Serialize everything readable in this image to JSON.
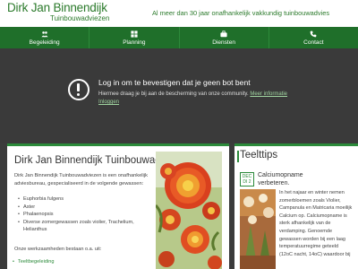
{
  "header": {
    "title": "Dirk Jan Binnendijk",
    "subtitle": "Tuinbouwadviezen",
    "tagline": "Al meer dan 30 jaar onafhankelijk vakkundig tuinbouwadvies"
  },
  "nav": {
    "items": [
      {
        "label": "Begeleiding",
        "icon": "people-icon"
      },
      {
        "label": "Planning",
        "icon": "grid-icon"
      },
      {
        "label": "Diensten",
        "icon": "briefcase-icon"
      },
      {
        "label": "Contact",
        "icon": "phone-icon"
      }
    ]
  },
  "alert": {
    "title": "Log in om te bevestigen dat je geen bot bent",
    "text": "Hiermee draag je bij aan de bescherming van onze community.",
    "link_more": "Meer informatie",
    "link_login": "Inloggen"
  },
  "main": {
    "title": "Dirk Jan Binnendijk Tuinbouwadviezen",
    "intro": "Dirk Jan Binnendijk Tuinbouwadviezen is een onafhankelijk adviesbureau, gespecialiseerd in de volgende gewassen:",
    "plants": [
      "Euphorbia fulgens",
      "Aster",
      "Phalaenopsis",
      "Diverse zomergewassen zoals violier, Trachelium, Helianthus"
    ],
    "werk": "Onze werkzaamheden bestaan o.a. uit:",
    "teeltbegeleiding": "Teeltbegeleiding"
  },
  "sidebar": {
    "title": "Teelttips",
    "date_month": "DEC",
    "date_day": "DI 2",
    "tip_title": "Calciumopname verbeteren.",
    "tip_text": "In het najaar en winter nemen zomerbloemen zoals Violier, Campanula en Matricaria moeilijk Calcium op. Calciumopname is sterk afhankelijk van de verdamping. Genoemde gewassen worden bij een laag temperatuurregime geteeld (12oC nacht, 14oC) waardoor bij"
  },
  "colors": {
    "brand_green": "#1f6f2a",
    "accent_green": "#2b8a3a",
    "dark_bg": "#3a3a3a"
  }
}
